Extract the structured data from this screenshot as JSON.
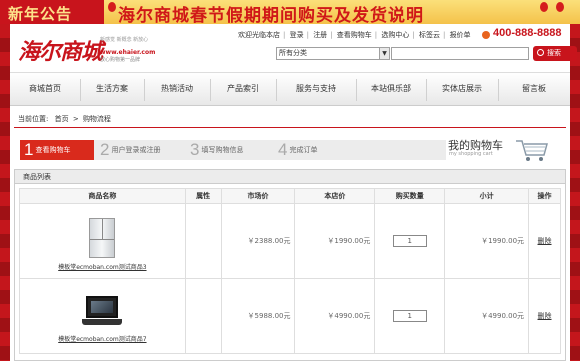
{
  "banner": {
    "left_text": "新年公告",
    "title": "海尔商城春节假期期间购买及发货说明"
  },
  "header": {
    "logo_text": "海尔商城",
    "logo_sub": "新感觉 新概念 新放心",
    "logo_url": "www.ehaier.com",
    "logo_slogan": "放心购物第一品牌",
    "top_links": [
      "欢迎光临本店",
      "登录",
      "注册",
      "查看购物车",
      "选购中心",
      "标签云",
      "报价单"
    ],
    "phone": "400-888-8888",
    "category_select": "所有分类",
    "search_button": "搜索"
  },
  "nav": [
    "商城首页",
    "生活方案",
    "热销活动",
    "产品索引",
    "服务与支持",
    "本站俱乐部",
    "实体店展示",
    "留言板"
  ],
  "breadcrumb": {
    "label": "当前位置:",
    "home": "首页",
    "sep": ">",
    "current": "购物流程"
  },
  "steps": [
    {
      "num": "1",
      "label": "查看购物车"
    },
    {
      "num": "2",
      "label": "用户登录或注册"
    },
    {
      "num": "3",
      "label": "填写购物信息"
    },
    {
      "num": "4",
      "label": "完成订单"
    }
  ],
  "cart": {
    "title": "我的购物车",
    "subtitle": "my shopping cart"
  },
  "panel_title": "商品列表",
  "table": {
    "headers": [
      "商品名称",
      "属性",
      "市场价",
      "本店价",
      "购买数量",
      "小计",
      "操作"
    ],
    "rows": [
      {
        "name": "模板堂ecmoban.com测试商品3",
        "attr": "",
        "market_price": "￥2388.00元",
        "shop_price": "￥1990.00元",
        "qty": "1",
        "subtotal": "￥1990.00元",
        "action": "删除",
        "icon": "fridge-icon"
      },
      {
        "name": "模板堂ecmoban.com测试商品7",
        "attr": "",
        "market_price": "￥5988.00元",
        "shop_price": "￥4990.00元",
        "qty": "1",
        "subtotal": "￥4990.00元",
        "action": "删除",
        "icon": "laptop-icon"
      }
    ]
  },
  "colors": {
    "brand_red": "#c8141c",
    "banner_gold": "#f4c24a",
    "step_active": "#d92a1c"
  }
}
